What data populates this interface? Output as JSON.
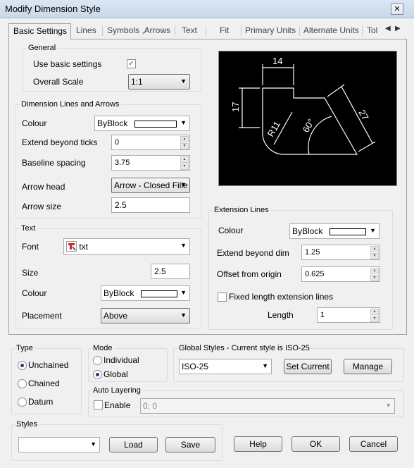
{
  "window": {
    "title": "Modify Dimension Style",
    "close_glyph": "✕"
  },
  "tabs": [
    "Basic Settings",
    "Lines",
    "Symbols ,Arrows",
    "Text",
    "Fit",
    "Primary Units",
    "Alternate Units",
    "Tol"
  ],
  "tab_scroll": {
    "left": "◀",
    "right": "▶"
  },
  "general": {
    "title": "General",
    "use_basic_label": "Use basic settings",
    "use_basic_checked": true,
    "check_glyph": "✓",
    "overall_scale_label": "Overall Scale",
    "overall_scale_value": "1:1"
  },
  "dimlines": {
    "title": "Dimension Lines and Arrows",
    "colour_label": "Colour",
    "colour_value": "ByBlock",
    "extend_label": "Extend beyond ticks",
    "extend_value": "0",
    "baseline_label": "Baseline spacing",
    "baseline_value": "3.75",
    "arrowhead_label": "Arrow head",
    "arrowhead_value": "Arrow - Closed Fille",
    "arrowsize_label": "Arrow size",
    "arrowsize_value": "2.5"
  },
  "text": {
    "title": "Text",
    "font_label": "Font",
    "font_value": "txt",
    "size_label": "Size",
    "size_value": "2.5",
    "colour_label": "Colour",
    "colour_value": "ByBlock",
    "placement_label": "Placement",
    "placement_value": "Above"
  },
  "extlines": {
    "title": "Extension Lines",
    "colour_label": "Colour",
    "colour_value": "ByBlock",
    "extend_label": "Extend beyond dim",
    "extend_value": "1.25",
    "offset_label": "Offset from origin",
    "offset_value": "0.625",
    "fixed_label": "Fixed length extension lines",
    "fixed_checked": false,
    "length_label": "Length",
    "length_value": "1"
  },
  "preview": {
    "dim_top": "14",
    "dim_left": "17",
    "dim_radius": "R11",
    "dim_angle": "60°",
    "dim_slant": "27"
  },
  "type": {
    "title": "Type",
    "options": [
      "Unchained",
      "Chained",
      "Datum"
    ],
    "selected": "Unchained"
  },
  "mode": {
    "title": "Mode",
    "options": [
      "Individual",
      "Global"
    ],
    "selected": "Global"
  },
  "global_styles": {
    "title": "Global Styles - Current style is ISO-25",
    "value": "ISO-25",
    "set_current": "Set Current",
    "manage": "Manage"
  },
  "auto_layering": {
    "title": "Auto Layering",
    "enable_label": "Enable",
    "enable_checked": false,
    "layer_value": "0: 0"
  },
  "styles": {
    "title": "Styles",
    "value": "",
    "load": "Load",
    "save": "Save"
  },
  "footer": {
    "help": "Help",
    "ok": "OK",
    "cancel": "Cancel"
  },
  "dropdown_glyph": "▼",
  "spin_up": "▲",
  "spin_down": "▼"
}
